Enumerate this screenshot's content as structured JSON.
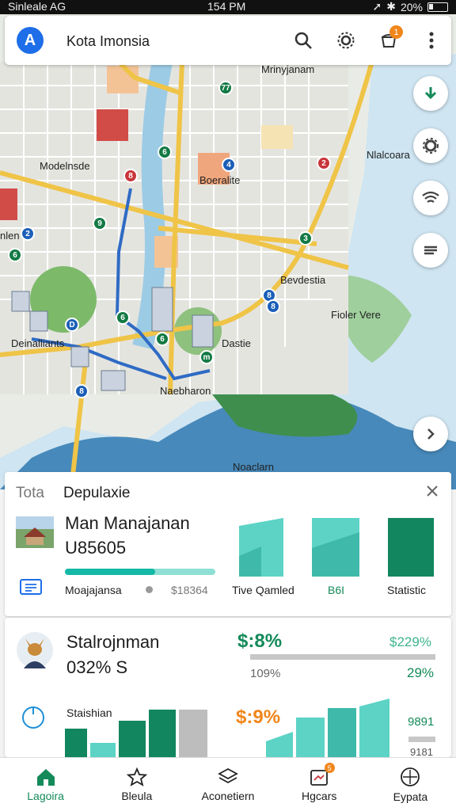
{
  "status_bar": {
    "carrier": "Sinleale AG",
    "time": "154 PM",
    "battery": "20%"
  },
  "app": {
    "logo_letter": "A",
    "title": "Kota Imonsia"
  },
  "header": {
    "notification_count": "1"
  },
  "map": {
    "labels": {
      "top": "Mrinyjanam",
      "left_upper": "Modelnsde",
      "center_upper": "Boeralite",
      "right_top": "Nlalcoara",
      "left_mid": "nlen",
      "center_right": "Bevdestia",
      "far_right": "Fioler Vere",
      "left_lower": "Deinalliants",
      "center_lower": "Dastie",
      "bay": "Naebharon",
      "bottom": "Noaclarn"
    },
    "pins": [
      "77",
      "6",
      "8",
      "4",
      "2",
      "9",
      "2",
      "6",
      "3",
      "8",
      "8",
      "6",
      "D",
      "6",
      "m",
      "8"
    ]
  },
  "panel": {
    "prefix": "Tota",
    "title": "Depulaxie",
    "item_name": "Man Manajanan",
    "item_code": "U85605",
    "progress": 0.6,
    "footer_left": "Moajajansa",
    "footer_value": "$18364",
    "chart1_label": "Tive Qamled",
    "chart2_label": "B6I",
    "chart3_label": "Statistic"
  },
  "stats": {
    "name": "Stalrojnman",
    "sub": "032% S",
    "big_value": "$:8%",
    "right_value": "$229%",
    "left_small": "109%",
    "right_small": "29%",
    "lower_label": "Staishian",
    "lower_value": "$:9%",
    "right_lower": "9891",
    "right_lower2": "9181"
  },
  "nav": {
    "items": [
      {
        "label": "Lagoira",
        "icon": "home-icon"
      },
      {
        "label": "Bleula",
        "icon": "star-icon"
      },
      {
        "label": "Aconetiern",
        "icon": "layers-icon"
      },
      {
        "label": "Hgcars",
        "icon": "inbox-icon"
      },
      {
        "label": "Eypata",
        "icon": "compass-icon"
      }
    ],
    "badge": "5"
  },
  "colors": {
    "accent": "#14b8a6",
    "primary_green": "#148a5a",
    "brand_blue": "#1d6ee8",
    "badge_orange": "#f0861a"
  }
}
